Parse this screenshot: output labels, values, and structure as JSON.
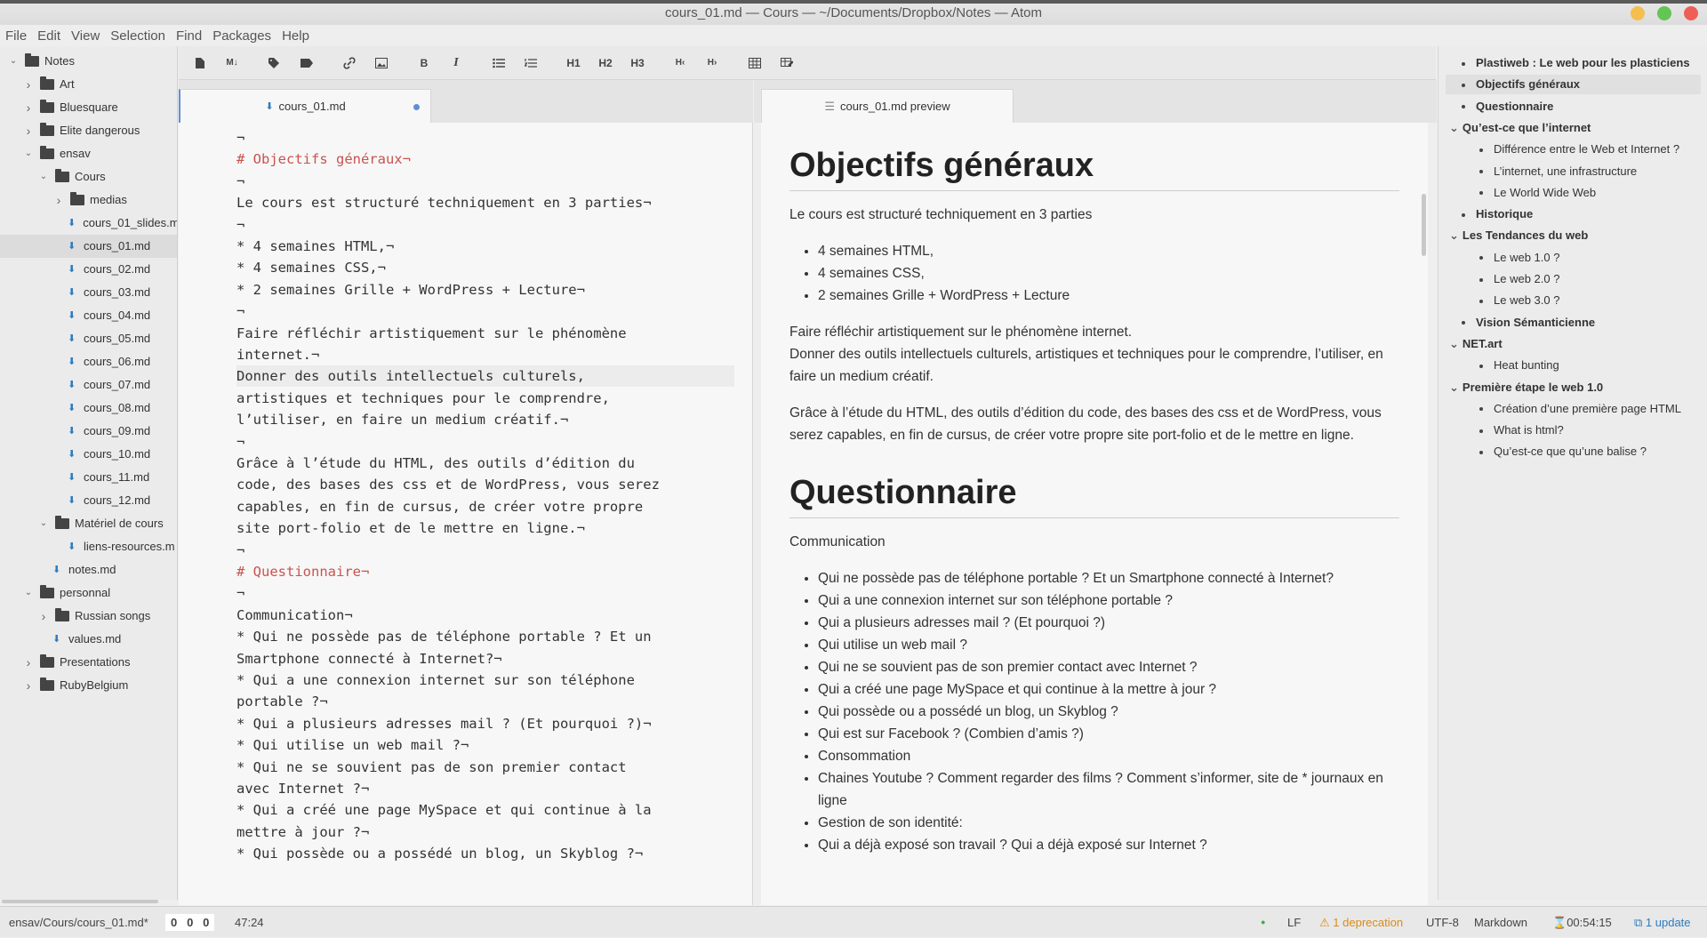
{
  "window": {
    "title": "cours_01.md — Cours — ~/Documents/Dropbox/Notes — Atom"
  },
  "menu": [
    "File",
    "Edit",
    "View",
    "Selection",
    "Find",
    "Packages",
    "Help"
  ],
  "tree": [
    {
      "label": "Notes",
      "depth": 0,
      "type": "folder",
      "open": true
    },
    {
      "label": "Art",
      "depth": 1,
      "type": "folder",
      "open": false
    },
    {
      "label": "Bluesquare",
      "depth": 1,
      "type": "folder",
      "open": false
    },
    {
      "label": "Elite dangerous",
      "depth": 1,
      "type": "folder",
      "open": false
    },
    {
      "label": "ensav",
      "depth": 1,
      "type": "folder",
      "open": true
    },
    {
      "label": "Cours",
      "depth": 2,
      "type": "folder",
      "open": true
    },
    {
      "label": "medias",
      "depth": 3,
      "type": "folder",
      "open": false
    },
    {
      "label": "cours_01_slides.m",
      "depth": 4,
      "type": "file"
    },
    {
      "label": "cours_01.md",
      "depth": 4,
      "type": "file",
      "selected": true
    },
    {
      "label": "cours_02.md",
      "depth": 4,
      "type": "file"
    },
    {
      "label": "cours_03.md",
      "depth": 4,
      "type": "file"
    },
    {
      "label": "cours_04.md",
      "depth": 4,
      "type": "file"
    },
    {
      "label": "cours_05.md",
      "depth": 4,
      "type": "file"
    },
    {
      "label": "cours_06.md",
      "depth": 4,
      "type": "file"
    },
    {
      "label": "cours_07.md",
      "depth": 4,
      "type": "file"
    },
    {
      "label": "cours_08.md",
      "depth": 4,
      "type": "file"
    },
    {
      "label": "cours_09.md",
      "depth": 4,
      "type": "file"
    },
    {
      "label": "cours_10.md",
      "depth": 4,
      "type": "file"
    },
    {
      "label": "cours_11.md",
      "depth": 4,
      "type": "file"
    },
    {
      "label": "cours_12.md",
      "depth": 4,
      "type": "file"
    },
    {
      "label": "Matériel de cours",
      "depth": 2,
      "type": "folder",
      "open": true
    },
    {
      "label": "liens-resources.m",
      "depth": 4,
      "type": "file"
    },
    {
      "label": "notes.md",
      "depth": 3,
      "type": "file"
    },
    {
      "label": "personnal",
      "depth": 1,
      "type": "folder",
      "open": true
    },
    {
      "label": "Russian songs",
      "depth": 2,
      "type": "folder",
      "open": false
    },
    {
      "label": "values.md",
      "depth": 3,
      "type": "file"
    },
    {
      "label": "Presentations",
      "depth": 1,
      "type": "folder",
      "open": false
    },
    {
      "label": "RubyBelgium",
      "depth": 1,
      "type": "folder",
      "open": false
    }
  ],
  "toolbar": [
    "new-file-icon",
    "markdown-icon",
    "tag-icon",
    "label-icon",
    "link-icon",
    "image-icon",
    "B",
    "I",
    "ul-icon",
    "ol-icon",
    "H1",
    "H2",
    "H3",
    "outdent-icon",
    "indent-icon",
    "table-icon",
    "table-edit-icon"
  ],
  "tabs": {
    "editor": "cours_01.md",
    "preview": "cours_01.md preview"
  },
  "editor_lines": [
    {
      "t": "¬",
      "k": "n"
    },
    {
      "t": "# Objectifs généraux¬",
      "k": "h"
    },
    {
      "t": "¬",
      "k": "n"
    },
    {
      "t": "Le cours est structuré techniquement en 3 parties¬",
      "k": "n"
    },
    {
      "t": "¬",
      "k": "n"
    },
    {
      "t": "* 4 semaines HTML,¬",
      "k": "n"
    },
    {
      "t": "* 4 semaines CSS,¬",
      "k": "n"
    },
    {
      "t": "* 2 semaines Grille + WordPress + Lecture¬",
      "k": "n"
    },
    {
      "t": "¬",
      "k": "n"
    },
    {
      "t": "Faire réfléchir artistiquement sur le phénomène",
      "k": "n"
    },
    {
      "t": "internet.¬",
      "k": "n"
    },
    {
      "t": "Donner des outils intellectuels culturels,",
      "k": "c"
    },
    {
      "t": "artistiques et techniques pour le comprendre,",
      "k": "n"
    },
    {
      "t": "l’utiliser, en faire un medium créatif.¬",
      "k": "n"
    },
    {
      "t": "¬",
      "k": "n"
    },
    {
      "t": "Grâce à l’étude du HTML, des outils d’édition du",
      "k": "n"
    },
    {
      "t": "code, des bases des css et de WordPress, vous serez",
      "k": "n"
    },
    {
      "t": "capables, en fin de cursus, de créer votre propre",
      "k": "n"
    },
    {
      "t": "site port-folio et de le mettre en ligne.¬",
      "k": "n"
    },
    {
      "t": "¬",
      "k": "n"
    },
    {
      "t": "# Questionnaire¬",
      "k": "h"
    },
    {
      "t": "¬",
      "k": "n"
    },
    {
      "t": "Communication¬",
      "k": "n"
    },
    {
      "t": "* Qui ne possède pas de téléphone portable ? Et un",
      "k": "n"
    },
    {
      "t": "Smartphone connecté à Internet?¬",
      "k": "n"
    },
    {
      "t": "* Qui a une connexion internet sur son téléphone",
      "k": "n"
    },
    {
      "t": "portable ?¬",
      "k": "n"
    },
    {
      "t": "* Qui a plusieurs adresses mail ? (Et pourquoi ?)¬",
      "k": "n"
    },
    {
      "t": "* Qui utilise un web mail ?¬",
      "k": "n"
    },
    {
      "t": "* Qui ne se souvient pas de son premier contact",
      "k": "n"
    },
    {
      "t": "avec Internet ?¬",
      "k": "n"
    },
    {
      "t": "* Qui a créé une page MySpace et qui continue à la",
      "k": "n"
    },
    {
      "t": "mettre à jour ?¬",
      "k": "n"
    },
    {
      "t": "* Qui possède ou a possédé un blog, un Skyblog ?¬",
      "k": "n"
    }
  ],
  "preview": {
    "h1_objectifs": "Objectifs généraux",
    "p_structure": "Le cours est structuré techniquement en 3 parties",
    "list_parts": [
      "4 semaines HTML,",
      "4 semaines CSS,",
      "2 semaines Grille + WordPress + Lecture"
    ],
    "p_faire_1": "Faire réfléchir artistiquement sur le phénomène internet.",
    "p_faire_2": "Donner des outils intellectuels culturels, artistiques et techniques pour le comprendre, l’utiliser, en faire un medium créatif.",
    "p_grace": "Grâce à l’étude du HTML, des outils d’édition du code, des bases des css et de WordPress, vous serez capables, en fin de cursus, de créer votre propre site port-folio et de le mettre en ligne.",
    "h1_questionnaire": "Questionnaire",
    "p_communication": "Communication",
    "list_questions": [
      "Qui ne possède pas de téléphone portable ? Et un Smartphone connecté à Internet?",
      "Qui a une connexion internet sur son téléphone portable ?",
      "Qui a plusieurs adresses mail ? (Et pourquoi ?)",
      "Qui utilise un web mail ?",
      "Qui ne se souvient pas de son premier contact avec Internet ?",
      "Qui a créé une page MySpace et qui continue à la mettre à jour ?",
      "Qui possède ou a possédé un blog, un Skyblog ?",
      "Qui est sur Facebook ? (Combien d’amis ?)",
      "Consommation",
      "Chaines Youtube ? Comment regarder des films ? Comment s’informer, site de * journaux en ligne",
      "Gestion de son identité:",
      "Qui a déjà exposé son travail ? Qui a déjà exposé sur Internet ?"
    ]
  },
  "outline": [
    {
      "label": "Plastiweb : Le web pour les plasticiens",
      "level": 1,
      "bold": true,
      "marker": "bullet"
    },
    {
      "label": "Objectifs généraux",
      "level": 1,
      "bold": true,
      "marker": "bullet",
      "selected": true
    },
    {
      "label": "Questionnaire",
      "level": 1,
      "bold": true,
      "marker": "bullet"
    },
    {
      "label": "Qu’est-ce que l’internet",
      "level": 1,
      "bold": true,
      "marker": "chevron"
    },
    {
      "label": "Différence entre le Web et Internet ?",
      "level": 2,
      "bold": false,
      "marker": "bullet"
    },
    {
      "label": "L’internet, une infrastructure",
      "level": 2,
      "bold": false,
      "marker": "bullet"
    },
    {
      "label": "Le World Wide Web",
      "level": 2,
      "bold": false,
      "marker": "bullet"
    },
    {
      "label": "Historique",
      "level": 1,
      "bold": true,
      "marker": "bullet"
    },
    {
      "label": "Les Tendances du web",
      "level": 1,
      "bold": true,
      "marker": "chevron"
    },
    {
      "label": "Le web 1.0 ?",
      "level": 2,
      "bold": false,
      "marker": "bullet"
    },
    {
      "label": "Le web 2.0 ?",
      "level": 2,
      "bold": false,
      "marker": "bullet"
    },
    {
      "label": "Le web 3.0 ?",
      "level": 2,
      "bold": false,
      "marker": "bullet"
    },
    {
      "label": "Vision Sémanticienne",
      "level": 1,
      "bold": true,
      "marker": "bullet"
    },
    {
      "label": "NET.art",
      "level": 1,
      "bold": true,
      "marker": "chevron"
    },
    {
      "label": "Heat bunting",
      "level": 2,
      "bold": false,
      "marker": "bullet"
    },
    {
      "label": "Première étape le web 1.0",
      "level": 1,
      "bold": true,
      "marker": "chevron"
    },
    {
      "label": "Création d’une première page HTML",
      "level": 2,
      "bold": false,
      "marker": "bullet"
    },
    {
      "label": "What is html?",
      "level": 2,
      "bold": false,
      "marker": "bullet"
    },
    {
      "label": "Qu’est-ce que qu’une balise ?",
      "level": 2,
      "bold": false,
      "marker": "bullet"
    }
  ],
  "status": {
    "path": "ensav/Cours/cours_01.md*",
    "counters": [
      "0",
      "0",
      "0"
    ],
    "cursor": "47:24",
    "line_ending": "LF",
    "deprecation": "1 deprecation",
    "encoding": "UTF-8",
    "grammar": "Markdown",
    "timer": "00:54:15",
    "update": "1 update"
  },
  "colors": {
    "heading": "#c9534f",
    "accent": "#5e8fd6",
    "warning": "#d98b1a",
    "green_dot": "#3cb043"
  }
}
